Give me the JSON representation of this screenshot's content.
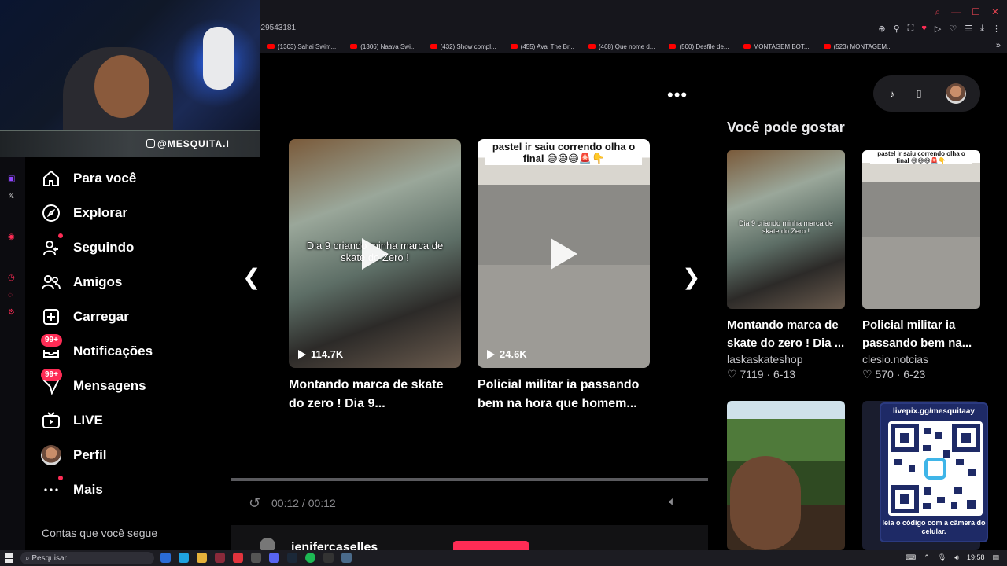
{
  "browser": {
    "url_fragment": "029543181",
    "bookmarks": [
      "(1303) Sahai Swim...",
      "(1306) Naava Swi...",
      "(432) Show compl...",
      "(455) Aval The Br...",
      "(468) Que nome d...",
      "(500) Desfile de...",
      "MONTAGEM BOT...",
      "(523) MONTAGEM..."
    ]
  },
  "webcam": {
    "handle": "@MESQUITA.I"
  },
  "sidebar": {
    "items": [
      {
        "label": "Para você",
        "icon": "home-icon"
      },
      {
        "label": "Explorar",
        "icon": "compass-icon"
      },
      {
        "label": "Seguindo",
        "icon": "following-icon"
      },
      {
        "label": "Amigos",
        "icon": "friends-icon"
      },
      {
        "label": "Carregar",
        "icon": "upload-icon"
      },
      {
        "label": "Notificações",
        "icon": "inbox-icon",
        "badge": "99+"
      },
      {
        "label": "Mensagens",
        "icon": "message-icon",
        "badge": "99+"
      },
      {
        "label": "LIVE",
        "icon": "live-icon"
      },
      {
        "label": "Perfil",
        "icon": "avatar"
      },
      {
        "label": "Mais",
        "icon": "more-icon"
      }
    ],
    "following_heading": "Contas que você segue"
  },
  "carousel": {
    "videos": [
      {
        "overlay_text": "Dia 9 criando minha marca de skate do Zero !",
        "views": "114.7K",
        "title": "Montando marca de skate do zero ! Dia 9..."
      },
      {
        "top_text": "pastel ir saiu correndo olha o final 😅😅😅🚨👇",
        "views": "24.6K",
        "title": "Policial militar ia passando bem na hora que homem..."
      }
    ]
  },
  "player": {
    "time": "00:12 / 00:12",
    "comment_user": "jenifercaselles"
  },
  "recommendations": {
    "heading": "Você pode gostar",
    "items": [
      {
        "overlay_text": "Dia 9 criando minha marca de skate do Zero !",
        "title": "Montando marca de skate do zero ! Dia ...",
        "author": "laskaskateshop",
        "likes": "7119",
        "date": "6-13"
      },
      {
        "overlay_text": "pastel ir saiu correndo olha o final 😅😅😅🚨👇",
        "title": "Policial militar ia passando bem na...",
        "author": "clesio.notcias",
        "likes": "570",
        "date": "6-23"
      }
    ]
  },
  "qr_overlay": {
    "url": "livepix.gg/mesquitaay",
    "hint": "leia o código com a câmera do celular."
  },
  "taskbar": {
    "search_placeholder": "Pesquisar",
    "clock": "19:58"
  },
  "colors": {
    "accent": "#fe2c55",
    "background": "#000000"
  }
}
